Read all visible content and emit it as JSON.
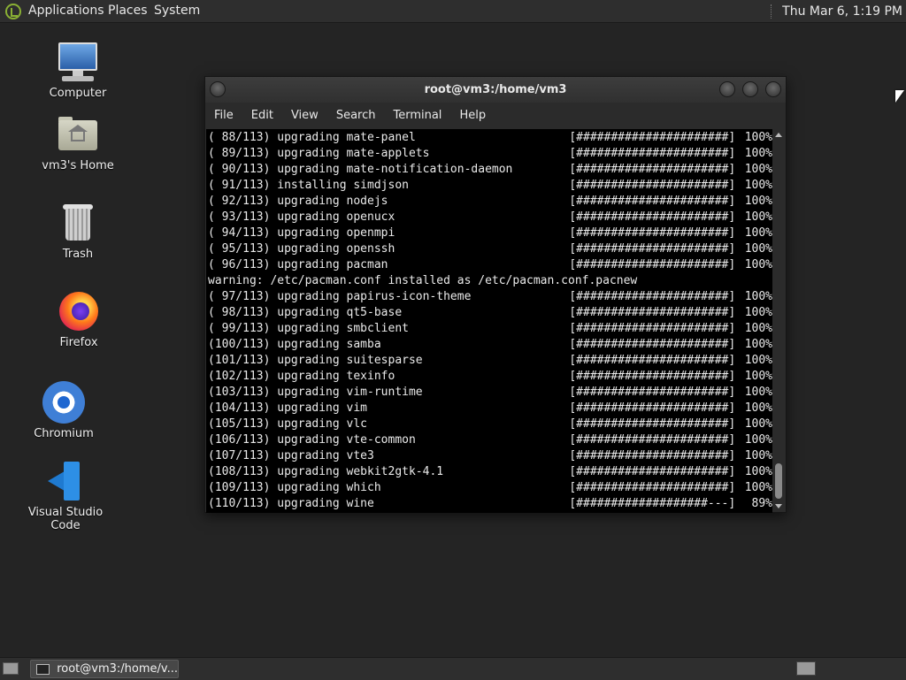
{
  "top_panel": {
    "applications": "Applications",
    "places": "Places",
    "system": "System",
    "clock": "Thu Mar  6,  1:19 PM"
  },
  "desktop_icons": [
    {
      "label": "Computer",
      "icon": "computer-icon"
    },
    {
      "label": "vm3's Home",
      "icon": "home-folder-icon"
    },
    {
      "label": "Trash",
      "icon": "trash-icon"
    },
    {
      "label": "Firefox",
      "icon": "firefox-icon"
    },
    {
      "label": "Chromium",
      "icon": "chromium-icon"
    },
    {
      "label": "Visual Studio Code",
      "icon": "vscode-icon"
    }
  ],
  "terminal": {
    "title": "root@vm3:/home/vm3",
    "menu": [
      "File",
      "Edit",
      "View",
      "Search",
      "Terminal",
      "Help"
    ],
    "lines": [
      {
        "text": "( 88/113) upgrading mate-panel",
        "bar": "[######################]",
        "pct": "100%"
      },
      {
        "text": "( 89/113) upgrading mate-applets",
        "bar": "[######################]",
        "pct": "100%"
      },
      {
        "text": "( 90/113) upgrading mate-notification-daemon",
        "bar": "[######################]",
        "pct": "100%"
      },
      {
        "text": "( 91/113) installing simdjson",
        "bar": "[######################]",
        "pct": "100%"
      },
      {
        "text": "( 92/113) upgrading nodejs",
        "bar": "[######################]",
        "pct": "100%"
      },
      {
        "text": "( 93/113) upgrading openucx",
        "bar": "[######################]",
        "pct": "100%"
      },
      {
        "text": "( 94/113) upgrading openmpi",
        "bar": "[######################]",
        "pct": "100%"
      },
      {
        "text": "( 95/113) upgrading openssh",
        "bar": "[######################]",
        "pct": "100%"
      },
      {
        "text": "( 96/113) upgrading pacman",
        "bar": "[######################]",
        "pct": "100%"
      },
      {
        "text": "warning: /etc/pacman.conf installed as /etc/pacman.conf.pacnew",
        "bar": "",
        "pct": ""
      },
      {
        "text": "( 97/113) upgrading papirus-icon-theme",
        "bar": "[######################]",
        "pct": "100%"
      },
      {
        "text": "( 98/113) upgrading qt5-base",
        "bar": "[######################]",
        "pct": "100%"
      },
      {
        "text": "( 99/113) upgrading smbclient",
        "bar": "[######################]",
        "pct": "100%"
      },
      {
        "text": "(100/113) upgrading samba",
        "bar": "[######################]",
        "pct": "100%"
      },
      {
        "text": "(101/113) upgrading suitesparse",
        "bar": "[######################]",
        "pct": "100%"
      },
      {
        "text": "(102/113) upgrading texinfo",
        "bar": "[######################]",
        "pct": "100%"
      },
      {
        "text": "(103/113) upgrading vim-runtime",
        "bar": "[######################]",
        "pct": "100%"
      },
      {
        "text": "(104/113) upgrading vim",
        "bar": "[######################]",
        "pct": "100%"
      },
      {
        "text": "(105/113) upgrading vlc",
        "bar": "[######################]",
        "pct": "100%"
      },
      {
        "text": "(106/113) upgrading vte-common",
        "bar": "[######################]",
        "pct": "100%"
      },
      {
        "text": "(107/113) upgrading vte3",
        "bar": "[######################]",
        "pct": "100%"
      },
      {
        "text": "(108/113) upgrading webkit2gtk-4.1",
        "bar": "[######################]",
        "pct": "100%"
      },
      {
        "text": "(109/113) upgrading which",
        "bar": "[######################]",
        "pct": "100%"
      },
      {
        "text": "(110/113) upgrading wine",
        "bar": "[###################---]",
        "pct": "89%"
      }
    ]
  },
  "taskbar": {
    "window_button": "root@vm3:/home/v..."
  }
}
